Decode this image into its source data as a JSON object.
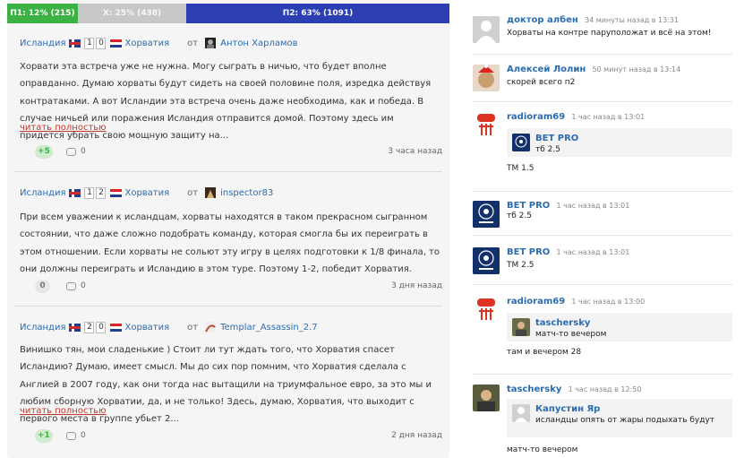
{
  "poll": {
    "p1": "П1: 12% (215)",
    "x": "Х: 25% (438)",
    "p2": "П2: 63% (1091)"
  },
  "posts": [
    {
      "team1": "Исландия",
      "score1": "1",
      "score2": "0",
      "team2": "Хорватия",
      "by": "от",
      "author": "Антон Харламов",
      "text": "Хорвати эта встреча уже не нужна. Могу сыграть в ничью, что будет вполне оправданно. Думаю хорваты будут сидеть на своей половине поля, изредка действуя контратаками. А вот Исландии эта встреча очень даже необходима, как и победа. В случае ничьей или поражения Исландия отправится домой. Поэтому здесь им придется убрать свою мощную защиту на...",
      "readmore": "читать полностью",
      "likes": "+5",
      "comments": "0",
      "time": "3 часа назад"
    },
    {
      "team1": "Исландия",
      "score1": "1",
      "score2": "2",
      "team2": "Хорватия",
      "by": "от",
      "author": "inspector83",
      "text": "При всем уважении к исландцам, хорваты находятся в таком прекрасном сыгранном состоянии, что даже сложно подобрать команду, которая смогла бы их переиграть в этом отношении. Если хорваты не сольют эту игру в целях подготовки к 1/8 финала, то они должны переиграть и Исландию в этом туре. Поэтому 1-2, победит Хорватия.",
      "likes": "0",
      "comments": "0",
      "time": "3 дня назад"
    },
    {
      "team1": "Исландия",
      "score1": "2",
      "score2": "0",
      "team2": "Хорватия",
      "by": "от",
      "author": "Templar_Assassin_2.7",
      "text": "Винишко тян, мои сладенькие ) Стоит ли тут ждать того, что Хорватия спасет Исландию? Думаю, имеет смысл. Мы до сих пор помним, что Хорватия сделала с Англией в 2007 году, как они тогда нас вытащили на триумфальное евро, за это мы и любим сборную Хорватии, да, и не только! Здесь, думаю, Хорватия, что выходит с первого места в группе убьет 2...",
      "readmore": "читать полностью",
      "likes": "+1",
      "comments": "0",
      "time": "2 дня назад"
    }
  ],
  "comments": [
    {
      "name": "доктор албен",
      "time": "34 минуты назад в 13:31",
      "text": "Хорваты на контре паруположат и всё на этом!"
    },
    {
      "name": "Алексей Лолин",
      "time": "50 минут назад в 13:14",
      "text": "скорей всего п2"
    },
    {
      "name": "radioram69",
      "time": "1 час назад в 13:01",
      "quote_name": "BET PRO",
      "quote_text": "тб 2.5",
      "text": "ТМ 1.5"
    },
    {
      "name": "BET PRO",
      "time": "1 час назад в 13:01",
      "text": "тб 2.5"
    },
    {
      "name": "BET PRO",
      "time": "1 час назад в 13:01",
      "text": "ТМ 2.5"
    },
    {
      "name": "radioram69",
      "time": "1 час назад в 13:00",
      "quote_name": "taschersky",
      "quote_text": "матч-то вечером",
      "text": "там и вечером 28"
    },
    {
      "name": "taschersky",
      "time": "1 час назад в 12:50",
      "quote_name": "Капустин Яр",
      "quote_text": "исландцы опять от жары подыхать будут",
      "text": "матч-то вечером"
    }
  ]
}
